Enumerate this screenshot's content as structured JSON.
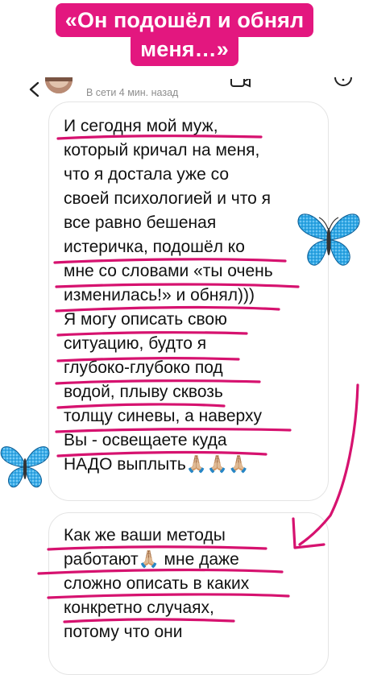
{
  "story_title": {
    "line1": "«Он подошёл и обнял",
    "line2": "меня…»"
  },
  "header": {
    "status": "В сети 4 мин. назад"
  },
  "messages": [
    {
      "lines": [
        "И сегодня мой муж,",
        "который кричал на меня,",
        "что я достала уже со",
        "своей психологией и что я",
        "все равно бешеная",
        "истеричка, подошёл ко",
        "мне со словами «ты очень",
        "изменилась!» и обнял)))",
        "Я могу описать свою",
        "ситуацию, будто я",
        "глубоко-глубоко под",
        "водой, плыву сквозь",
        "толщу синевы, а наверху",
        "Вы - освещаете куда",
        "НАДО выплыть🙏🏼🙏🏼🙏🏼"
      ]
    },
    {
      "lines": [
        "Как же ваши методы",
        "работают🙏🏼 мне даже",
        "сложно описать в каких",
        "конкретно случаях,",
        "потому что они"
      ]
    }
  ],
  "colors": {
    "banner": "#e3177f",
    "underline": "#d6126f",
    "butterfly": "#2fa8e6",
    "bubble_border": "#e4e4e4",
    "status_text": "#8e8e8e"
  },
  "icons": [
    "back-arrow-icon",
    "video-call-icon",
    "info-icon",
    "butterfly-sticker",
    "arrow-annotation"
  ]
}
